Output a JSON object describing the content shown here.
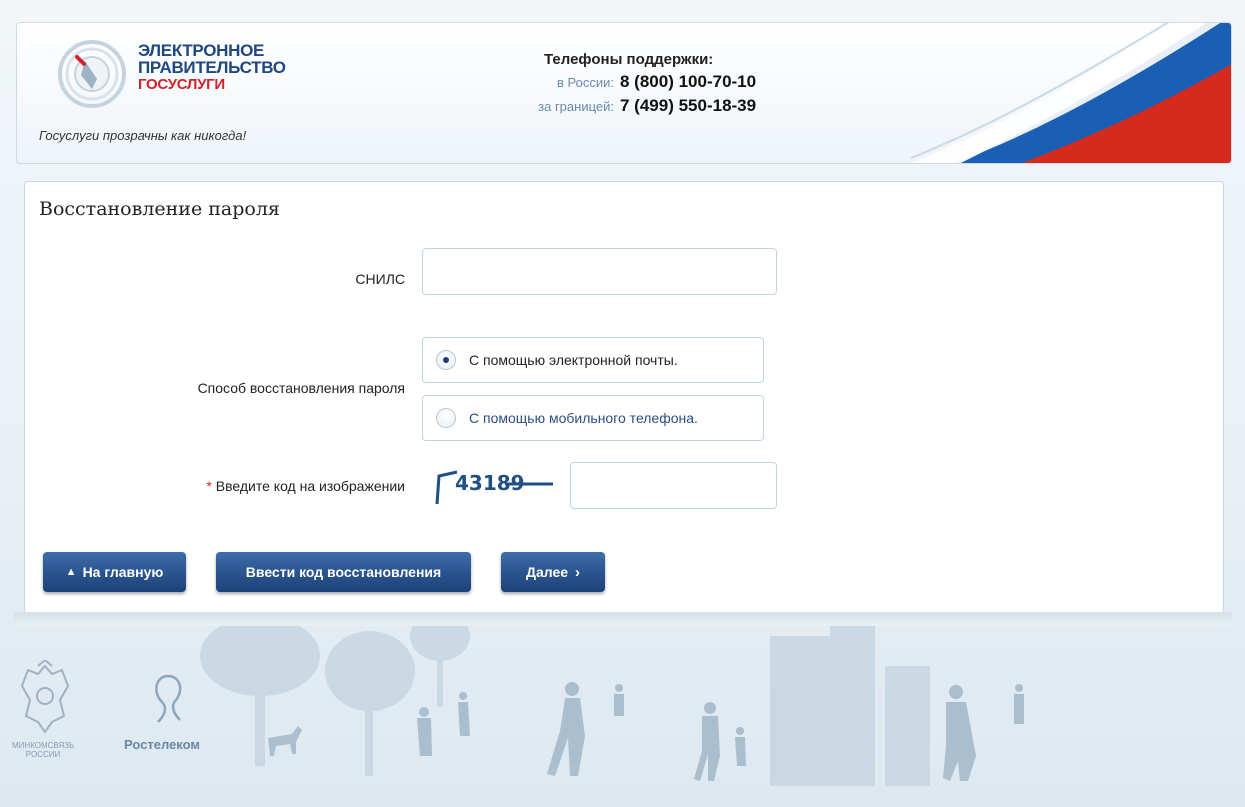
{
  "header": {
    "logo_line1": "ЭЛЕКТРОННОЕ",
    "logo_line2": "ПРАВИТЕЛЬСТВО",
    "logo_line3": "ГОСУСЛУГИ",
    "tagline": "Госуслуги прозрачны как никогда!",
    "support_title": "Телефоны поддержки:",
    "phones": [
      {
        "label": "в России:",
        "number": "8 (800) 100-70-10"
      },
      {
        "label": "за границей:",
        "number": "7 (499) 550-18-39"
      }
    ]
  },
  "form": {
    "title": "Восстановление пароля",
    "snils_label": "СНИЛС",
    "snils_value": "",
    "method_label": "Способ восстановления пароля",
    "methods": [
      {
        "label": "С помощью электронной почты.",
        "selected": true
      },
      {
        "label": "С помощью мобильного телефона.",
        "selected": false
      }
    ],
    "captcha_required_mark": "*",
    "captcha_label": "Введите код на изображении",
    "captcha_image_text": "43189",
    "captcha_value": ""
  },
  "buttons": {
    "home": "На главную",
    "enter_code": "Ввести код восстановления",
    "next": "Далее"
  },
  "footer": {
    "ministry_line1": "МИНКОМСВЯЗЬ",
    "ministry_line2": "РОССИИ",
    "rostelecom": "Ростелеком"
  },
  "colors": {
    "brand_blue": "#20487e",
    "brand_red": "#d2232a",
    "button_blue": "#2b5590",
    "link_blue": "#2a4f85"
  }
}
